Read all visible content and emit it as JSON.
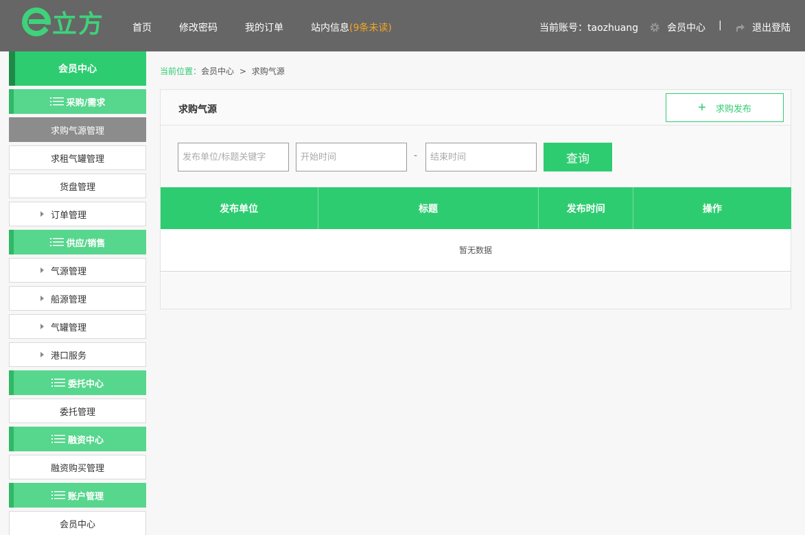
{
  "header": {
    "logo_text": "立方",
    "nav": [
      {
        "label": "首页"
      },
      {
        "label": "修改密码"
      },
      {
        "label": "我的订单"
      }
    ],
    "messages_label": "站内信息",
    "messages_unread": "(9条未读)",
    "account_label": "当前账号：taozhuang",
    "member_center": "会员中心",
    "separator": "|",
    "logout": "退出登陆",
    "colors": {
      "bg": "#666666",
      "accent": "#2ecc71",
      "unread": "#f5a623"
    }
  },
  "sidebar": {
    "title": "会员中心",
    "groups": [
      {
        "title": "采购/需求",
        "items": [
          {
            "label": "求购气源管理",
            "active": true,
            "arrow": false
          },
          {
            "label": "求租气罐管理",
            "active": false,
            "arrow": false
          },
          {
            "label": "货盘管理",
            "active": false,
            "arrow": false
          },
          {
            "label": "订单管理",
            "active": false,
            "arrow": true
          }
        ]
      },
      {
        "title": "供应/销售",
        "items": [
          {
            "label": "气源管理",
            "active": false,
            "arrow": true
          },
          {
            "label": "船源管理",
            "active": false,
            "arrow": true
          },
          {
            "label": "气罐管理",
            "active": false,
            "arrow": true
          },
          {
            "label": "港口服务",
            "active": false,
            "arrow": true
          }
        ]
      },
      {
        "title": "委托中心",
        "items": [
          {
            "label": "委托管理",
            "active": false,
            "arrow": false
          }
        ]
      },
      {
        "title": "融资中心",
        "items": [
          {
            "label": "融资购买管理",
            "active": false,
            "arrow": false
          }
        ]
      },
      {
        "title": "账户管理",
        "items": [
          {
            "label": "会员中心",
            "active": false,
            "arrow": false
          }
        ]
      }
    ]
  },
  "breadcrumb": {
    "label": "当前位置：",
    "path1": "会员中心",
    "sep": ">",
    "path2": "求购气源"
  },
  "panel": {
    "title": "求购气源",
    "publish_label": "求购发布"
  },
  "search": {
    "keyword_placeholder": "发布单位/标题关键字",
    "start_placeholder": "开始时间",
    "dash": "-",
    "end_placeholder": "结束时间",
    "query_label": "查询"
  },
  "table": {
    "columns": [
      "发布单位",
      "标题",
      "发布时间",
      "操作"
    ],
    "empty_text": "暂无数据"
  }
}
